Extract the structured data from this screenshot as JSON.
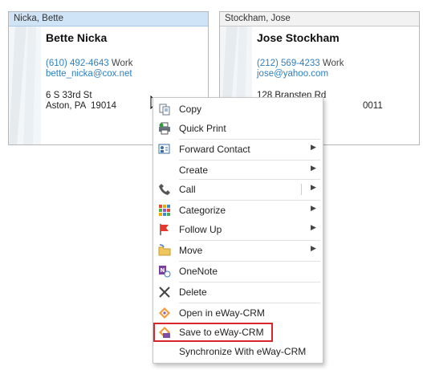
{
  "cards": [
    {
      "header": "Nicka, Bette",
      "name": "Bette Nicka",
      "phone": "(610) 492-4643",
      "phone_type": "Work",
      "email": "bette_nicka@cox.net",
      "address_line1": "6 S 33rd St",
      "address_line2": "Aston, PA  19014"
    },
    {
      "header": "Stockham, Jose",
      "name": "Jose Stockham",
      "phone": "(212) 569-4233",
      "phone_type": "Work",
      "email": "jose@yahoo.com",
      "address_line1": "128 Bransten Rd",
      "address_line2": "0011"
    }
  ],
  "menu": {
    "items": [
      {
        "label": "Copy",
        "icon": "copy-icon"
      },
      {
        "label": "Quick Print",
        "icon": "print-icon"
      },
      {
        "label": "Forward Contact",
        "icon": "forward-contact-icon"
      },
      {
        "label": "Create",
        "icon": ""
      },
      {
        "label": "Call",
        "icon": "phone-icon"
      },
      {
        "label": "Categorize",
        "icon": "categorize-icon"
      },
      {
        "label": "Follow Up",
        "icon": "flag-icon"
      },
      {
        "label": "Move",
        "icon": "folder-move-icon"
      },
      {
        "label": "OneNote",
        "icon": "onenote-icon"
      },
      {
        "label": "Delete",
        "icon": "delete-icon"
      },
      {
        "label": "Open in eWay-CRM",
        "icon": "eway-open-icon"
      },
      {
        "label": "Save to eWay-CRM",
        "icon": "eway-save-icon"
      },
      {
        "label": "Synchronize With eWay-CRM",
        "icon": ""
      }
    ]
  },
  "colors": {
    "highlight_box": "#d9252b",
    "link_blue": "#2f7fbf",
    "selected_header": "#cfe5f7"
  }
}
